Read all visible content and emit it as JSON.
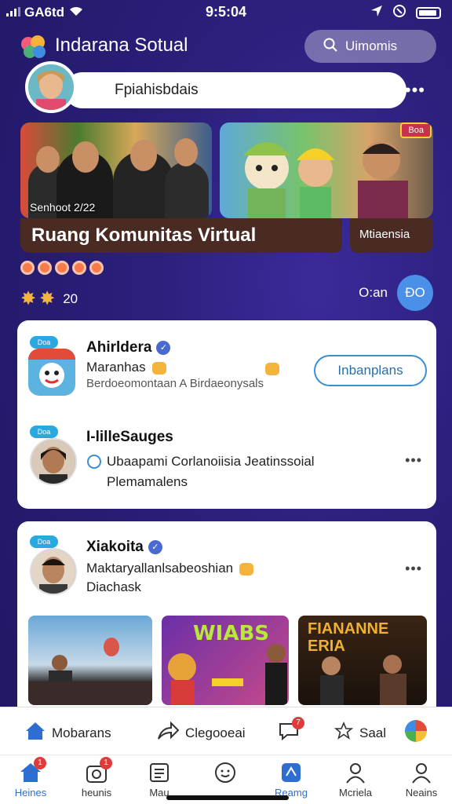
{
  "status": {
    "carrier": "GA6td",
    "time": "9:5:04"
  },
  "header": {
    "title": "Indarana Sotual",
    "search_label": "Uimomis"
  },
  "composer": {
    "placeholder_text": "Fpiahisbdais"
  },
  "hero": {
    "left_caption": "Senhoot 2/22",
    "banner_title": "Ruang Komunitas Virtual",
    "right_label": "Mtiaensia",
    "right_badge": "Boa"
  },
  "stats": {
    "count": "20",
    "right_label": "O:an",
    "circle_label": "ĐO"
  },
  "posts": [
    {
      "tag": "Doa",
      "name": "Ahirldera",
      "subtitle": "Maranhas",
      "meta": "Berdoeomontaan A Birdaeonysals",
      "button": "Inbanplans"
    },
    {
      "tag": "Doa",
      "name": "I-lilleSauges",
      "line1": "Ubaapami Corlanoiisia Jeatinssoial",
      "line2": "Plemamalens"
    },
    {
      "tag": "Doa",
      "name": "Xiakoita",
      "subtitle": "Maktaryallanlsabeoshian",
      "meta": "Diachask"
    }
  ],
  "gallery": [
    {
      "label": ""
    },
    {
      "label": "WIABS"
    },
    {
      "label": "FIANANNE ERIA"
    }
  ],
  "actions": {
    "home": "Mobarans",
    "share": "Clegooeai",
    "comment_badge": "7",
    "save": "Saal"
  },
  "tabs": [
    {
      "label": "Heines",
      "badge": "1"
    },
    {
      "label": "heunis",
      "badge": "1"
    },
    {
      "label": "Mau"
    },
    {
      "label": ""
    },
    {
      "label": "Reamg"
    },
    {
      "label": "Mcriela"
    },
    {
      "label": "Neains"
    }
  ],
  "colors": {
    "accent": "#2e6ed0",
    "background": "#2a1f7a",
    "badge": "#e03a3a"
  }
}
